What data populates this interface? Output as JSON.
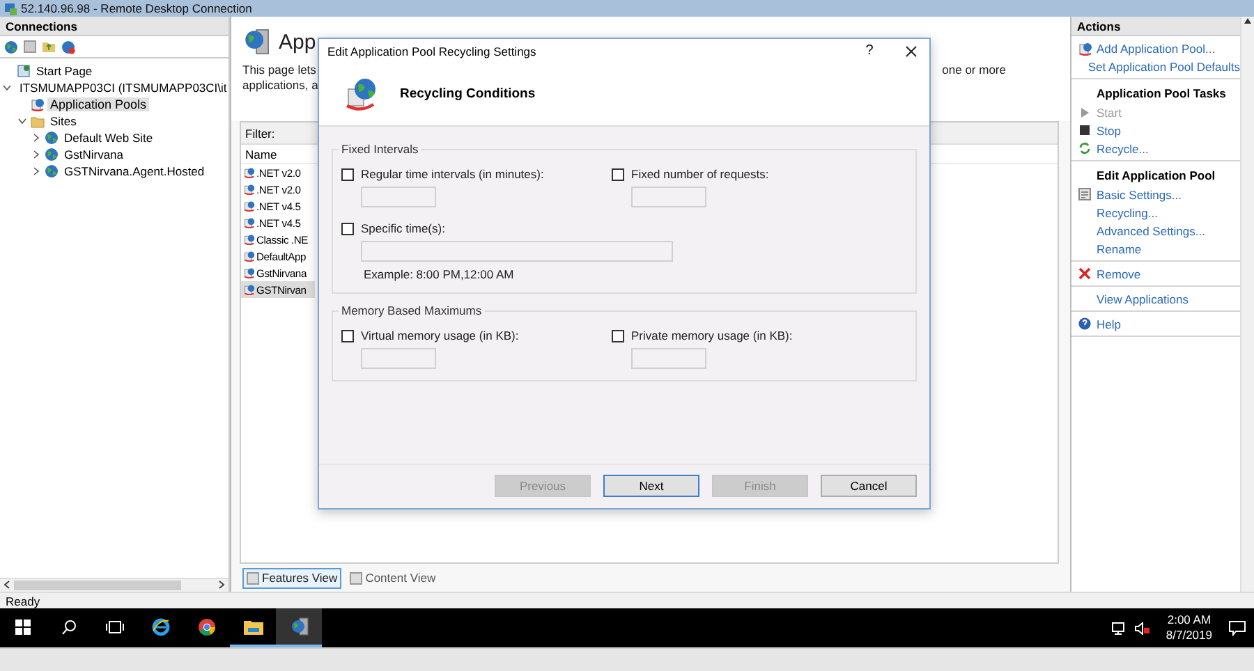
{
  "window": {
    "title": "52.140.96.98 - Remote Desktop Connection"
  },
  "connections": {
    "title": "Connections",
    "tree": [
      {
        "label": "Start Page",
        "kind": "page",
        "selected": false
      },
      {
        "label": "ITSMUMAPP03CI (ITSMUMAPP03CI\\it",
        "kind": "server",
        "expanded": true,
        "selected": false,
        "children": [
          {
            "label": "Application Pools",
            "kind": "pools",
            "selected": true
          },
          {
            "label": "Sites",
            "kind": "folder",
            "expanded": true,
            "selected": false,
            "children": [
              {
                "label": "Default Web Site",
                "kind": "site",
                "expanded": false,
                "selected": false
              },
              {
                "label": "GstNirvana",
                "kind": "site",
                "expanded": false,
                "selected": false
              },
              {
                "label": "GSTNirvana.Agent.Hosted",
                "kind": "site",
                "expanded": false,
                "selected": false
              }
            ]
          }
        ]
      }
    ]
  },
  "features": {
    "heading": "App",
    "description_left": [
      "This page lets",
      "applications, a"
    ],
    "description_right": "one or more",
    "filter_label": "Filter:",
    "column": "Name",
    "rows": [
      {
        "name": ".NET v2.0",
        "selected": false
      },
      {
        "name": ".NET v2.0",
        "selected": false
      },
      {
        "name": ".NET v4.5",
        "selected": false
      },
      {
        "name": ".NET v4.5",
        "selected": false
      },
      {
        "name": "Classic .NE",
        "selected": false
      },
      {
        "name": "DefaultApp",
        "selected": false
      },
      {
        "name": "GstNirvana",
        "selected": false
      },
      {
        "name": "GSTNirvan",
        "selected": true
      }
    ],
    "views": [
      {
        "label": "Features View",
        "selected": true
      },
      {
        "label": "Content View",
        "selected": false
      }
    ]
  },
  "actions": {
    "title": "Actions",
    "groups": [
      {
        "items": [
          {
            "label": "Add Application Pool...",
            "kind": "add",
            "disabled": false
          },
          {
            "label": "Set Application Pool Defaults",
            "kind": "plain",
            "disabled": false
          }
        ]
      },
      {
        "heading": "Application Pool Tasks",
        "items": [
          {
            "label": "Start",
            "kind": "start",
            "disabled": true
          },
          {
            "label": "Stop",
            "kind": "stop",
            "disabled": false
          },
          {
            "label": "Recycle...",
            "kind": "recycle",
            "disabled": false
          }
        ]
      },
      {
        "heading": "Edit Application Pool",
        "items": [
          {
            "label": "Basic Settings...",
            "kind": "settings",
            "disabled": false
          },
          {
            "label": "Recycling...",
            "kind": "plain",
            "disabled": false
          },
          {
            "label": "Advanced Settings...",
            "kind": "plain",
            "disabled": false
          },
          {
            "label": "Rename",
            "kind": "plain",
            "disabled": false
          }
        ]
      },
      {
        "items": [
          {
            "label": "Remove",
            "kind": "remove",
            "disabled": false
          }
        ]
      },
      {
        "items": [
          {
            "label": "View Applications",
            "kind": "plain",
            "disabled": false
          }
        ]
      },
      {
        "items": [
          {
            "label": "Help",
            "kind": "help",
            "disabled": false
          }
        ]
      }
    ]
  },
  "status_bar": {
    "text": "Ready"
  },
  "taskbar": {
    "apps": [
      {
        "kind": "start",
        "running": false,
        "active": false
      },
      {
        "kind": "search",
        "running": false,
        "active": false
      },
      {
        "kind": "taskview",
        "running": false,
        "active": false
      },
      {
        "kind": "ie",
        "running": false,
        "active": false
      },
      {
        "kind": "chrome",
        "running": false,
        "active": false
      },
      {
        "kind": "explorer",
        "running": true,
        "active": false
      },
      {
        "kind": "iis",
        "running": true,
        "active": true
      }
    ],
    "time": "2:00 AM",
    "date": "8/7/2019"
  },
  "dialog": {
    "title": "Edit Application Pool Recycling Settings",
    "help": "?",
    "heading": "Recycling Conditions",
    "groups": [
      {
        "title": "Fixed Intervals",
        "fields": [
          {
            "label": "Regular time intervals (in minutes):",
            "checked": false,
            "kind": "short"
          },
          {
            "label": "Fixed number of requests:",
            "checked": false,
            "kind": "short"
          },
          {
            "label": "Specific time(s):",
            "checked": false,
            "kind": "wide",
            "example": "Example: 8:00 PM,12:00 AM"
          }
        ]
      },
      {
        "title": "Memory Based Maximums",
        "fields": [
          {
            "label": "Virtual memory usage (in KB):",
            "checked": false,
            "kind": "short"
          },
          {
            "label": "Private memory usage (in KB):",
            "checked": false,
            "kind": "short"
          }
        ]
      }
    ],
    "buttons": [
      {
        "label": "Previous",
        "disabled": true,
        "default": false
      },
      {
        "label": "Next",
        "disabled": false,
        "default": true
      },
      {
        "label": "Finish",
        "disabled": true,
        "default": false
      },
      {
        "label": "Cancel",
        "disabled": false,
        "default": false
      }
    ]
  }
}
